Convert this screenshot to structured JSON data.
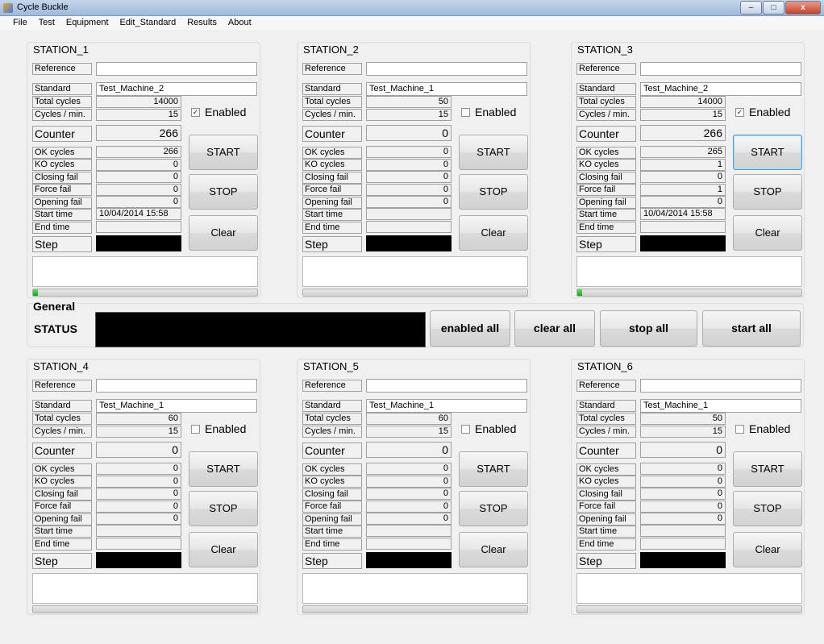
{
  "window": {
    "title": "Cycle Buckle",
    "controls": [
      "–",
      "□",
      "x"
    ]
  },
  "menu": [
    "File",
    "Test",
    "Equipment",
    "Edit_Standard",
    "Results",
    "About"
  ],
  "labels": {
    "reference": "Reference",
    "standard": "Standard",
    "total_cycles": "Total cycles",
    "cycles_min": "Cycles / min.",
    "counter": "Counter",
    "ok_cycles": "OK cycles",
    "ko_cycles": "KO cycles",
    "closing_fail": "Closing fail",
    "force_fail": "Force fail",
    "opening_fail": "Opening fail",
    "start_time": "Start time",
    "end_time": "End time",
    "step": "Step",
    "enabled": "Enabled",
    "start": "START",
    "stop": "STOP",
    "clear": "Clear"
  },
  "stations": [
    {
      "title": "STATION_1",
      "reference": "",
      "standard": "Test_Machine_2",
      "total_cycles": "14000",
      "cycles_min": "15",
      "enabled": true,
      "counter": "266",
      "ok": "266",
      "ko": "0",
      "closing": "0",
      "force": "0",
      "opening": "0",
      "start_time": "10/04/2014  15:58",
      "end_time": "",
      "progress": 0.02,
      "start_focused": false
    },
    {
      "title": "STATION_2",
      "reference": "",
      "standard": "Test_Machine_1",
      "total_cycles": "50",
      "cycles_min": "15",
      "enabled": false,
      "counter": "0",
      "ok": "0",
      "ko": "0",
      "closing": "0",
      "force": "0",
      "opening": "0",
      "start_time": "",
      "end_time": "",
      "progress": 0,
      "start_focused": false
    },
    {
      "title": "STATION_3",
      "reference": "",
      "standard": "Test_Machine_2",
      "total_cycles": "14000",
      "cycles_min": "15",
      "enabled": true,
      "counter": "266",
      "ok": "265",
      "ko": "1",
      "closing": "0",
      "force": "1",
      "opening": "0",
      "start_time": "10/04/2014  15:58",
      "end_time": "",
      "progress": 0.02,
      "start_focused": true
    },
    {
      "title": "STATION_4",
      "reference": "",
      "standard": "Test_Machine_1",
      "total_cycles": "60",
      "cycles_min": "15",
      "enabled": false,
      "counter": "0",
      "ok": "0",
      "ko": "0",
      "closing": "0",
      "force": "0",
      "opening": "0",
      "start_time": "",
      "end_time": "",
      "progress": 0,
      "start_focused": false
    },
    {
      "title": "STATION_5",
      "reference": "",
      "standard": "Test_Machine_1",
      "total_cycles": "60",
      "cycles_min": "15",
      "enabled": false,
      "counter": "0",
      "ok": "0",
      "ko": "0",
      "closing": "0",
      "force": "0",
      "opening": "0",
      "start_time": "",
      "end_time": "",
      "progress": 0,
      "start_focused": false
    },
    {
      "title": "STATION_6",
      "reference": "",
      "standard": "Test_Machine_1",
      "total_cycles": "50",
      "cycles_min": "15",
      "enabled": false,
      "counter": "0",
      "ok": "0",
      "ko": "0",
      "closing": "0",
      "force": "0",
      "opening": "0",
      "start_time": "",
      "end_time": "",
      "progress": 0,
      "start_focused": false
    }
  ],
  "general": {
    "title": "General",
    "status_label": "STATUS",
    "buttons": [
      "enabled all",
      "clear  all",
      "stop all",
      "start all"
    ]
  },
  "colors": {
    "progress": "#22c022",
    "status_box": "#000000",
    "focus_border": "#3c9fd6"
  }
}
